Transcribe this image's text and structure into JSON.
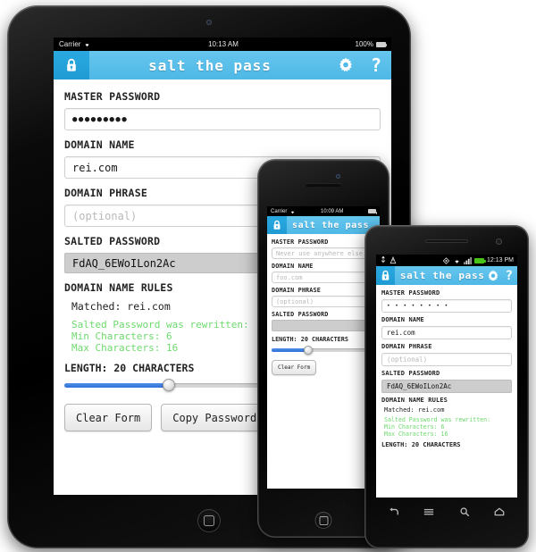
{
  "app": {
    "title": "salt the pass",
    "lock_icon": "lock-icon",
    "settings_icon": "gear-icon",
    "help_icon": "question-mark-icon"
  },
  "labels": {
    "master_password": "MASTER PASSWORD",
    "domain_name": "DOMAIN NAME",
    "domain_phrase": "DOMAIN PHRASE",
    "salted_password": "SALTED PASSWORD",
    "domain_name_rules": "DOMAIN NAME RULES"
  },
  "ipad": {
    "statusbar": {
      "carrier": "Carrier",
      "wifi_icon": "wifi-icon",
      "time": "10:13 AM",
      "battery_text": "100%",
      "battery_icon": "battery-full-icon"
    },
    "master_password_value": "●●●●●●●●●",
    "domain_name_value": "rei.com",
    "domain_phrase_placeholder": "(optional)",
    "salted_password_value": "FdAQ_6EWoILon2Ac",
    "rules": {
      "matched": "Matched: rei.com",
      "green_lines": [
        "Salted Password was rewritten:",
        "Min Characters: 6",
        "Max Characters: 16"
      ]
    },
    "length_label": "LENGTH: 20 CHARACTERS",
    "slider": {
      "value": 20,
      "percent": 33
    },
    "buttons": {
      "clear": "Clear Form",
      "copy": "Copy Password"
    },
    "home_button": "home-button"
  },
  "iphone": {
    "statusbar": {
      "carrier": "Carrier",
      "wifi_icon": "wifi-icon",
      "time": "10:09 AM",
      "battery_icon": "battery-full-icon"
    },
    "master_password_placeholder": "Never use anywhere else",
    "domain_name_placeholder": "foo.com",
    "domain_phrase_placeholder": "(optional)",
    "salted_password_value": "",
    "length_label": "LENGTH: 20 CHARACTERS",
    "slider": {
      "value": 20,
      "percent": 35
    },
    "buttons": {
      "clear": "Clear Form"
    },
    "home_button": "home-button"
  },
  "android": {
    "statusbar": {
      "usb_icon": "usb-icon",
      "debug_icon": "debug-icon",
      "sync_icon": "sync-icon",
      "wifi_icon": "wifi-icon",
      "signal_icon": "signal-icon",
      "battery_icon": "battery-full-icon",
      "time": "12:13 PM"
    },
    "master_password_value": "• • • • • • • •",
    "domain_name_value": "rei.com",
    "domain_phrase_placeholder": "(optional)",
    "salted_password_value": "FdAQ_6EWoILon2Ac",
    "rules": {
      "matched": "Matched: rei.com",
      "green_lines": [
        "Salted Password was rewritten:",
        "Min Characters: 6",
        "Max Characters: 16"
      ]
    },
    "length_label": "LENGTH: 20 CHARACTERS",
    "nav": {
      "back_icon": "back-arrow-icon",
      "menu_icon": "menu-icon",
      "search_icon": "search-icon",
      "home_icon": "home-icon"
    }
  },
  "colors": {
    "appbar": "#4eb8e6",
    "appbar_lock": "#2aa9e0",
    "salt_field": "#cdcdcd",
    "green_text": "#6ed96e",
    "slider_fill": "#2f6fd8"
  }
}
